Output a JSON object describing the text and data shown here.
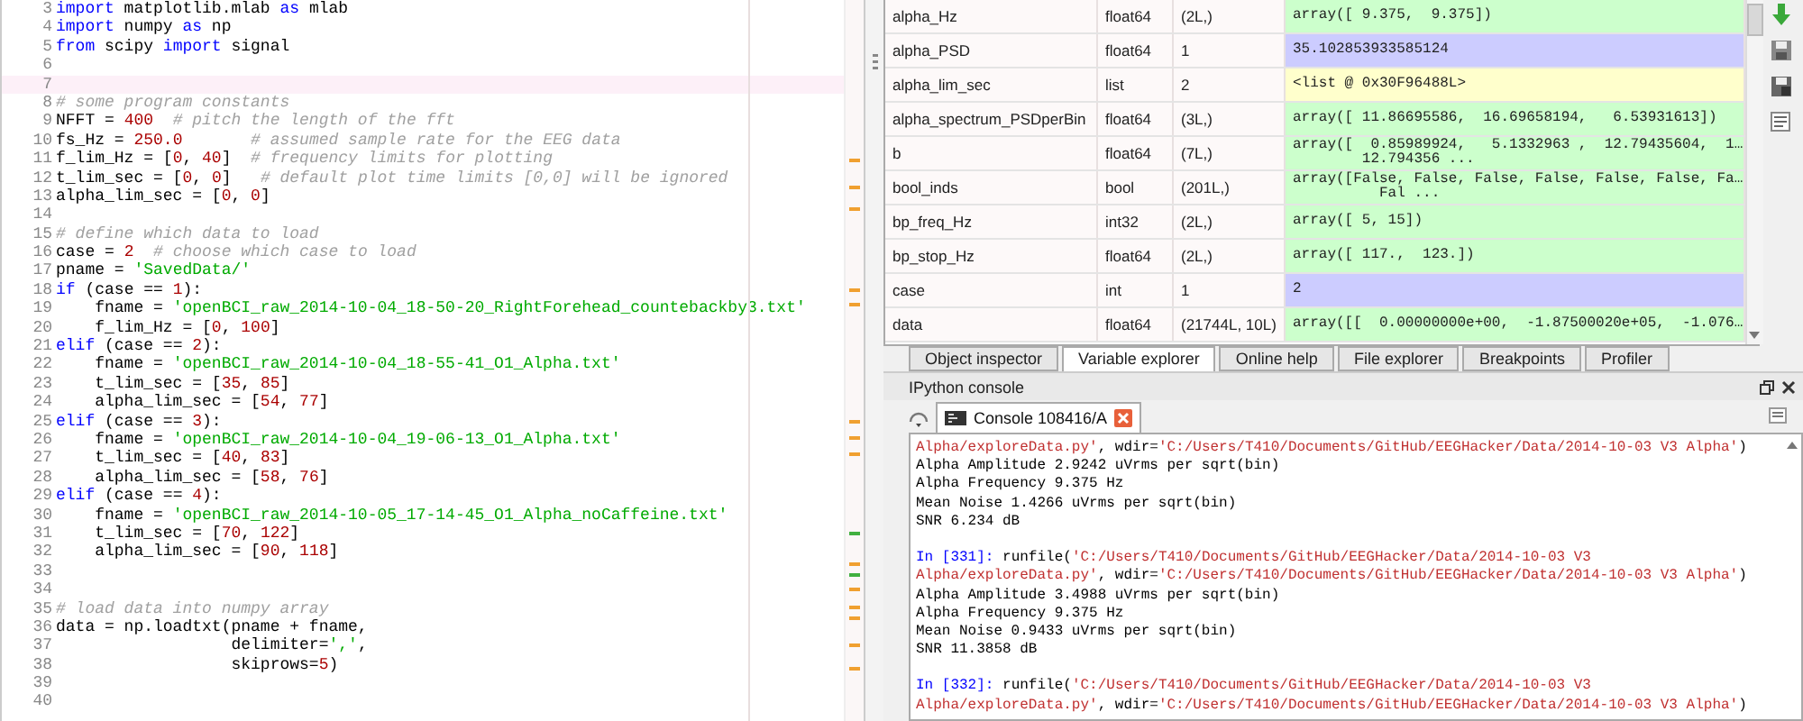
{
  "editor": {
    "lines": [
      {
        "number": "3",
        "current": false,
        "segments": [
          {
            "kind": "keyword",
            "text": "import"
          },
          {
            "kind": "plain",
            "text": " matplotlib.mlab "
          },
          {
            "kind": "keyword",
            "text": "as"
          },
          {
            "kind": "plain",
            "text": " mlab"
          }
        ]
      },
      {
        "number": "4",
        "current": false,
        "segments": [
          {
            "kind": "keyword",
            "text": "import"
          },
          {
            "kind": "plain",
            "text": " numpy "
          },
          {
            "kind": "keyword",
            "text": "as"
          },
          {
            "kind": "plain",
            "text": " np"
          }
        ]
      },
      {
        "number": "5",
        "current": false,
        "segments": [
          {
            "kind": "keyword",
            "text": "from"
          },
          {
            "kind": "plain",
            "text": " scipy "
          },
          {
            "kind": "keyword",
            "text": "import"
          },
          {
            "kind": "plain",
            "text": " signal"
          }
        ]
      },
      {
        "number": "6",
        "current": false
      },
      {
        "number": "7",
        "current": true
      },
      {
        "number": "8",
        "current": false,
        "segments": [
          {
            "kind": "comment",
            "text": "# some program constants"
          }
        ]
      },
      {
        "number": "9",
        "current": false,
        "segments": [
          {
            "kind": "plain",
            "text": "NFFT = "
          },
          {
            "kind": "number",
            "text": "400"
          },
          {
            "kind": "comment",
            "text": "  # pitch the length of the fft"
          }
        ]
      },
      {
        "number": "10",
        "current": false,
        "segments": [
          {
            "kind": "plain",
            "text": "fs_Hz = "
          },
          {
            "kind": "number",
            "text": "250.0"
          },
          {
            "kind": "comment",
            "text": "       # assumed sample rate for the EEG data"
          }
        ]
      },
      {
        "number": "11",
        "current": false,
        "segments": [
          {
            "kind": "plain",
            "text": "f_lim_Hz = ["
          },
          {
            "kind": "number",
            "text": "0"
          },
          {
            "kind": "plain",
            "text": ", "
          },
          {
            "kind": "number",
            "text": "40"
          },
          {
            "kind": "plain",
            "text": "]  "
          },
          {
            "kind": "comment",
            "text": "# frequency limits for plotting"
          }
        ]
      },
      {
        "number": "12",
        "current": false,
        "segments": [
          {
            "kind": "plain",
            "text": "t_lim_sec = ["
          },
          {
            "kind": "number",
            "text": "0"
          },
          {
            "kind": "plain",
            "text": ", "
          },
          {
            "kind": "number",
            "text": "0"
          },
          {
            "kind": "plain",
            "text": "]   "
          },
          {
            "kind": "comment",
            "text": "# default plot time limits [0,0] will be ignored"
          }
        ]
      },
      {
        "number": "13",
        "current": false,
        "segments": [
          {
            "kind": "plain",
            "text": "alpha_lim_sec = ["
          },
          {
            "kind": "number",
            "text": "0"
          },
          {
            "kind": "plain",
            "text": ", "
          },
          {
            "kind": "number",
            "text": "0"
          },
          {
            "kind": "plain",
            "text": "]"
          }
        ]
      },
      {
        "number": "14",
        "current": false
      },
      {
        "number": "15",
        "current": false,
        "segments": [
          {
            "kind": "comment",
            "text": "# define which data to load"
          }
        ]
      },
      {
        "number": "16",
        "current": false,
        "segments": [
          {
            "kind": "plain",
            "text": "case = "
          },
          {
            "kind": "number",
            "text": "2"
          },
          {
            "kind": "comment",
            "text": "  # choose which case to load"
          }
        ]
      },
      {
        "number": "17",
        "current": false,
        "segments": [
          {
            "kind": "plain",
            "text": "pname = "
          },
          {
            "kind": "string",
            "text": "'SavedData/'"
          }
        ]
      },
      {
        "number": "18",
        "current": false,
        "segments": [
          {
            "kind": "keyword",
            "text": "if"
          },
          {
            "kind": "plain",
            "text": " (case == "
          },
          {
            "kind": "number",
            "text": "1"
          },
          {
            "kind": "plain",
            "text": "):"
          }
        ]
      },
      {
        "number": "19",
        "current": false,
        "segments": [
          {
            "kind": "plain",
            "text": "    fname = "
          },
          {
            "kind": "string",
            "text": "'openBCI_raw_2014-10-04_18-50-20_RightForehead_countebackby3.txt'"
          }
        ]
      },
      {
        "number": "20",
        "current": false,
        "segments": [
          {
            "kind": "plain",
            "text": "    f_lim_Hz = ["
          },
          {
            "kind": "number",
            "text": "0"
          },
          {
            "kind": "plain",
            "text": ", "
          },
          {
            "kind": "number",
            "text": "100"
          },
          {
            "kind": "plain",
            "text": "]"
          }
        ]
      },
      {
        "number": "21",
        "current": false,
        "segments": [
          {
            "kind": "keyword",
            "text": "elif"
          },
          {
            "kind": "plain",
            "text": " (case == "
          },
          {
            "kind": "number",
            "text": "2"
          },
          {
            "kind": "plain",
            "text": "):"
          }
        ]
      },
      {
        "number": "22",
        "current": false,
        "segments": [
          {
            "kind": "plain",
            "text": "    fname = "
          },
          {
            "kind": "string",
            "text": "'openBCI_raw_2014-10-04_18-55-41_O1_Alpha.txt'"
          }
        ]
      },
      {
        "number": "23",
        "current": false,
        "segments": [
          {
            "kind": "plain",
            "text": "    t_lim_sec = ["
          },
          {
            "kind": "number",
            "text": "35"
          },
          {
            "kind": "plain",
            "text": ", "
          },
          {
            "kind": "number",
            "text": "85"
          },
          {
            "kind": "plain",
            "text": "]"
          }
        ]
      },
      {
        "number": "24",
        "current": false,
        "segments": [
          {
            "kind": "plain",
            "text": "    alpha_lim_sec = ["
          },
          {
            "kind": "number",
            "text": "54"
          },
          {
            "kind": "plain",
            "text": ", "
          },
          {
            "kind": "number",
            "text": "77"
          },
          {
            "kind": "plain",
            "text": "]"
          }
        ]
      },
      {
        "number": "25",
        "current": false,
        "segments": [
          {
            "kind": "keyword",
            "text": "elif"
          },
          {
            "kind": "plain",
            "text": " (case == "
          },
          {
            "kind": "number",
            "text": "3"
          },
          {
            "kind": "plain",
            "text": "):"
          }
        ]
      },
      {
        "number": "26",
        "current": false,
        "segments": [
          {
            "kind": "plain",
            "text": "    fname = "
          },
          {
            "kind": "string",
            "text": "'openBCI_raw_2014-10-04_19-06-13_O1_Alpha.txt'"
          }
        ]
      },
      {
        "number": "27",
        "current": false,
        "segments": [
          {
            "kind": "plain",
            "text": "    t_lim_sec = ["
          },
          {
            "kind": "number",
            "text": "40"
          },
          {
            "kind": "plain",
            "text": ", "
          },
          {
            "kind": "number",
            "text": "83"
          },
          {
            "kind": "plain",
            "text": "]"
          }
        ]
      },
      {
        "number": "28",
        "current": false,
        "segments": [
          {
            "kind": "plain",
            "text": "    alpha_lim_sec = ["
          },
          {
            "kind": "number",
            "text": "58"
          },
          {
            "kind": "plain",
            "text": ", "
          },
          {
            "kind": "number",
            "text": "76"
          },
          {
            "kind": "plain",
            "text": "]"
          }
        ]
      },
      {
        "number": "29",
        "current": false,
        "segments": [
          {
            "kind": "keyword",
            "text": "elif"
          },
          {
            "kind": "plain",
            "text": " (case == "
          },
          {
            "kind": "number",
            "text": "4"
          },
          {
            "kind": "plain",
            "text": "):"
          }
        ]
      },
      {
        "number": "30",
        "current": false,
        "segments": [
          {
            "kind": "plain",
            "text": "    fname = "
          },
          {
            "kind": "string",
            "text": "'openBCI_raw_2014-10-05_17-14-45_O1_Alpha_noCaffeine.txt'"
          }
        ]
      },
      {
        "number": "31",
        "current": false,
        "segments": [
          {
            "kind": "plain",
            "text": "    t_lim_sec = ["
          },
          {
            "kind": "number",
            "text": "70"
          },
          {
            "kind": "plain",
            "text": ", "
          },
          {
            "kind": "number",
            "text": "122"
          },
          {
            "kind": "plain",
            "text": "]"
          }
        ]
      },
      {
        "number": "32",
        "current": false,
        "segments": [
          {
            "kind": "plain",
            "text": "    alpha_lim_sec = ["
          },
          {
            "kind": "number",
            "text": "90"
          },
          {
            "kind": "plain",
            "text": ", "
          },
          {
            "kind": "number",
            "text": "118"
          },
          {
            "kind": "plain",
            "text": "]"
          }
        ]
      },
      {
        "number": "33",
        "current": false
      },
      {
        "number": "34",
        "current": false
      },
      {
        "number": "35",
        "current": false,
        "segments": [
          {
            "kind": "comment",
            "text": "# load data into numpy array"
          }
        ]
      },
      {
        "number": "36",
        "current": false,
        "segments": [
          {
            "kind": "plain",
            "text": "data = np.loadtxt(pname + fname,"
          }
        ]
      },
      {
        "number": "37",
        "current": false,
        "segments": [
          {
            "kind": "plain",
            "text": "                  delimiter="
          },
          {
            "kind": "string",
            "text": "','"
          },
          {
            "kind": "plain",
            "text": ","
          }
        ]
      },
      {
        "number": "38",
        "current": false,
        "segments": [
          {
            "kind": "plain",
            "text": "                  skiprows="
          },
          {
            "kind": "number",
            "text": "5"
          },
          {
            "kind": "plain",
            "text": ")"
          }
        ]
      },
      {
        "number": "39",
        "current": false
      },
      {
        "number": "40",
        "current": false
      }
    ]
  },
  "variable_explorer": {
    "rows": [
      {
        "name": "alpha_Hz",
        "type": "float64",
        "size": "(2L,)",
        "value": "array([ 9.375,  9.375])",
        "color": "#ccffcc"
      },
      {
        "name": "alpha_PSD",
        "type": "float64",
        "size": "1",
        "value": "35.102853933585124",
        "color": "#ccccff"
      },
      {
        "name": "alpha_lim_sec",
        "type": "list",
        "size": "2",
        "value": "<list @ 0x30F96488L>",
        "color": "#ffffcc"
      },
      {
        "name": "alpha_spectrum_PSDperBin",
        "type": "float64",
        "size": "(3L,)",
        "value": "array([ 11.86695586,  16.69658194,   6.53931613])",
        "color": "#ccffcc"
      },
      {
        "name": "b",
        "type": "float64",
        "size": "(7L,)",
        "value": "array([  0.85989924,   5.1332963 ,  12.79435604,  1…\n        12.794356 ...",
        "color": "#ccffcc"
      },
      {
        "name": "bool_inds",
        "type": "bool",
        "size": "(201L,)",
        "value": "array([False, False, False, False, False, False, Fa…\n          Fal ...",
        "color": "#ccffcc"
      },
      {
        "name": "bp_freq_Hz",
        "type": "int32",
        "size": "(2L,)",
        "value": "array([ 5, 15])",
        "color": "#ccffcc"
      },
      {
        "name": "bp_stop_Hz",
        "type": "float64",
        "size": "(2L,)",
        "value": "array([ 117.,  123.])",
        "color": "#ccffcc"
      },
      {
        "name": "case",
        "type": "int",
        "size": "1",
        "value": "2",
        "color": "#ccccff"
      },
      {
        "name": "data",
        "type": "float64",
        "size": "(21744L, 10L)",
        "value": "array([[  0.00000000e+00,  -1.87500020e+05,  -1.076…",
        "color": "#ccffcc"
      }
    ]
  },
  "pane_tabs": [
    {
      "label": "Object inspector",
      "selected": false
    },
    {
      "label": "Variable explorer",
      "selected": true
    },
    {
      "label": "Online help",
      "selected": false
    },
    {
      "label": "File explorer",
      "selected": false
    },
    {
      "label": "Breakpoints",
      "selected": false
    },
    {
      "label": "Profiler",
      "selected": false
    }
  ],
  "console": {
    "title": "IPython console",
    "tabs": [
      {
        "label": "Console 108416/A",
        "selected": true
      }
    ],
    "lines": [
      {
        "segments": [
          {
            "kind": "string",
            "text": "Alpha/exploreData.py'"
          },
          {
            "kind": "plain",
            "text": ", wdir="
          },
          {
            "kind": "string",
            "text": "'C:/Users/T410/Documents/GitHub/EEGHacker/Data/2014-10-03 V3 Alpha'"
          },
          {
            "kind": "plain",
            "text": ")"
          }
        ]
      },
      {
        "segments": [
          {
            "kind": "plain",
            "text": "Alpha Amplitude 2.9242 uVrms per sqrt(bin)"
          }
        ]
      },
      {
        "segments": [
          {
            "kind": "plain",
            "text": "Alpha Frequency 9.375 Hz"
          }
        ]
      },
      {
        "segments": [
          {
            "kind": "plain",
            "text": "Mean Noise 1.4266 uVrms per sqrt(bin)"
          }
        ]
      },
      {
        "segments": [
          {
            "kind": "plain",
            "text": "SNR 6.234 dB"
          }
        ]
      },
      {
        "gap_before": true,
        "segments": [
          {
            "kind": "prompt",
            "text": "In [331]:"
          },
          {
            "kind": "plain",
            "text": " runfile("
          },
          {
            "kind": "string",
            "text": "'C:/Users/T410/Documents/GitHub/EEGHacker/Data/2014-10-03 V3"
          }
        ]
      },
      {
        "segments": [
          {
            "kind": "string",
            "text": "Alpha/exploreData.py'"
          },
          {
            "kind": "plain",
            "text": ", wdir="
          },
          {
            "kind": "string",
            "text": "'C:/Users/T410/Documents/GitHub/EEGHacker/Data/2014-10-03 V3 Alpha'"
          },
          {
            "kind": "plain",
            "text": ")"
          }
        ]
      },
      {
        "segments": [
          {
            "kind": "plain",
            "text": "Alpha Amplitude 3.4988 uVrms per sqrt(bin)"
          }
        ]
      },
      {
        "segments": [
          {
            "kind": "plain",
            "text": "Alpha Frequency 9.375 Hz"
          }
        ]
      },
      {
        "segments": [
          {
            "kind": "plain",
            "text": "Mean Noise 0.9433 uVrms per sqrt(bin)"
          }
        ]
      },
      {
        "segments": [
          {
            "kind": "plain",
            "text": "SNR 11.3858 dB"
          }
        ]
      },
      {
        "gap_before": true,
        "segments": [
          {
            "kind": "prompt",
            "text": "In [332]:"
          },
          {
            "kind": "plain",
            "text": " runfile("
          },
          {
            "kind": "string",
            "text": "'C:/Users/T410/Documents/GitHub/EEGHacker/Data/2014-10-03 V3"
          }
        ]
      },
      {
        "segments": [
          {
            "kind": "string",
            "text": "Alpha/exploreData.py'"
          },
          {
            "kind": "plain",
            "text": ", wdir="
          },
          {
            "kind": "string",
            "text": "'C:/Users/T410/Documents/GitHub/EEGHacker/Data/2014-10-03 V3 Alpha'"
          },
          {
            "kind": "plain",
            "text": ")"
          }
        ]
      }
    ]
  }
}
